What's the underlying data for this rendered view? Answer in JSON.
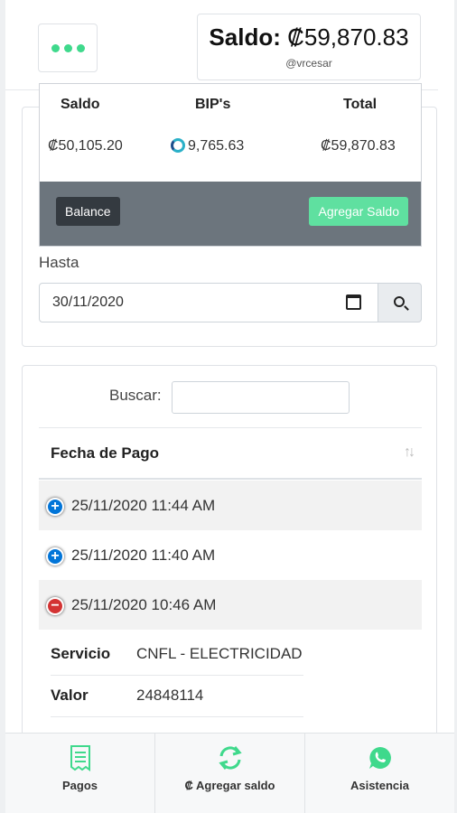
{
  "header": {
    "saldo_label": "Saldo:",
    "saldo_amount": "₡59,870.83",
    "username": "@vrcesar"
  },
  "popup": {
    "columns": [
      "Saldo",
      "BIP's",
      "Total"
    ],
    "values": {
      "saldo": "₡50,105.20",
      "bips": "9,765.63",
      "total": "₡59,870.83"
    },
    "balance_button": "Balance",
    "agregar_button": "Agregar Saldo"
  },
  "filter": {
    "hasta_label": "Hasta",
    "hasta_value": "30/11/2020"
  },
  "list": {
    "search_label": "Buscar:",
    "search_value": "",
    "column_header": "Fecha de Pago",
    "rows": [
      {
        "date": "25/11/2020 11:44 AM",
        "expanded": false
      },
      {
        "date": "25/11/2020 11:40 AM",
        "expanded": false
      },
      {
        "date": "25/11/2020 10:46 AM",
        "expanded": true
      }
    ],
    "details": [
      {
        "key": "Servicio",
        "value": "CNFL - ELECTRICIDAD"
      },
      {
        "key": "Valor",
        "value": "24848114"
      }
    ]
  },
  "bottom_nav": {
    "pagos": "Pagos",
    "agregar_saldo": "₡ Agregar saldo",
    "asistencia": "Asistencia"
  },
  "colors": {
    "accent": "#3fd98c",
    "footer_gray": "#6c757d",
    "plus": "#0275d8",
    "minus": "#d33333"
  }
}
